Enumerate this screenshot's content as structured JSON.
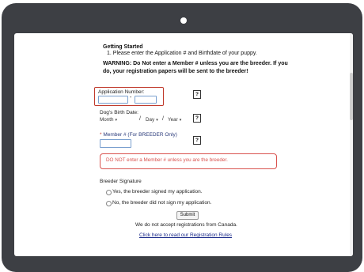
{
  "form": {
    "heading": "Getting Started",
    "step": "1. Please enter the Application # and Birthdate of your puppy.",
    "warning": "WARNING: Do Not enter a Member # unless you are the breeder. If you do, your registration papers will be sent to the breeder!",
    "application_label": "Application Number:",
    "application_dash": "-",
    "help_label": "?",
    "dob_label": "Dog's Birth Date:",
    "month": "Month",
    "day": "Day",
    "year": "Year",
    "slash": "/",
    "member_star": "*",
    "member_label": "Member # (For BREEDER Only)",
    "error_message": "DO NOT enter a Member # unless you are the breeder.",
    "breeder_signature_label": "Breeder Signature",
    "option_yes": "Yes, the breeder signed my application.",
    "option_no": "No, the breeder did not sign my application.",
    "submit": "Submit",
    "canada_note": "We do not accept registrations from Canada.",
    "rules_link": "Click here to read our Registration Rules"
  },
  "icons": {
    "select_arrow": "chevron-down-icon"
  }
}
